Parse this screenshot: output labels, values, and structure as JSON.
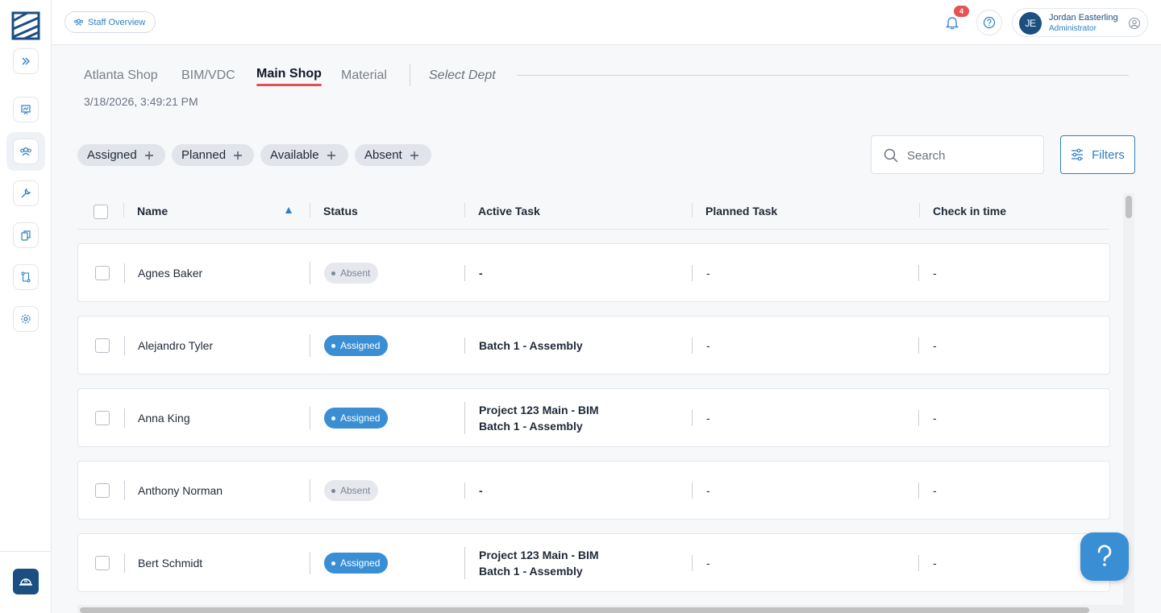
{
  "colors": {
    "accent": "#2f7fc1",
    "brand": "#1b4f82",
    "assigned": "#3a8fd4",
    "absent_bg": "#e6e8ee",
    "tab_underline": "#e05252",
    "badge": "#e55353"
  },
  "sidebar": {
    "items": [
      {
        "icon": "presentation-icon"
      },
      {
        "icon": "staff-icon",
        "active": true
      },
      {
        "icon": "wrench-icon"
      },
      {
        "icon": "copy-icon"
      },
      {
        "icon": "workflow-icon"
      },
      {
        "icon": "gear-icon"
      }
    ],
    "bottom_icon": "hardhat-icon"
  },
  "header": {
    "breadcrumb": "Staff Overview",
    "notification_count": "4",
    "user": {
      "initials": "JE",
      "name": "Jordan Easterling",
      "role": "Administrator"
    }
  },
  "tabs": {
    "items": [
      "Atlanta Shop",
      "BIM/VDC",
      "Main Shop",
      "Material"
    ],
    "active": "Main Shop",
    "select_placeholder": "Select Dept"
  },
  "timestamp": "3/18/2026, 3:49:21 PM",
  "chips": [
    "Assigned",
    "Planned",
    "Available",
    "Absent"
  ],
  "search": {
    "placeholder": "Search",
    "value": ""
  },
  "filters_label": "Filters",
  "table": {
    "columns": [
      "Name",
      "Status",
      "Active Task",
      "Planned Task",
      "Check in time"
    ],
    "rows": [
      {
        "name": "Agnes Baker",
        "status": "Absent",
        "active_task": [
          "-"
        ],
        "planned_task": "-",
        "check_in": "-"
      },
      {
        "name": "Alejandro Tyler",
        "status": "Assigned",
        "active_task": [
          "Batch 1 - Assembly"
        ],
        "planned_task": "-",
        "check_in": "-"
      },
      {
        "name": "Anna King",
        "status": "Assigned",
        "active_task": [
          "Project 123 Main - BIM",
          "Batch 1 - Assembly"
        ],
        "planned_task": "-",
        "check_in": "-"
      },
      {
        "name": "Anthony Norman",
        "status": "Absent",
        "active_task": [
          "-"
        ],
        "planned_task": "-",
        "check_in": "-"
      },
      {
        "name": "Bert Schmidt",
        "status": "Assigned",
        "active_task": [
          "Project 123 Main - BIM",
          "Batch 1 - Assembly"
        ],
        "planned_task": "-",
        "check_in": "-"
      }
    ]
  },
  "help_fab_label": "?"
}
